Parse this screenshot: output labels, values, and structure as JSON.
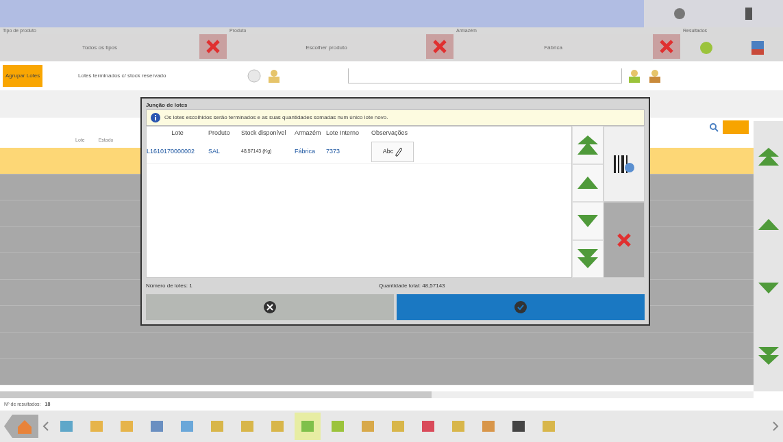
{
  "filters": [
    {
      "label": "Tipo de produto",
      "value": "Todos os tipos"
    },
    {
      "label": "Produto",
      "value": "Escolher produto"
    },
    {
      "label": "Armazém",
      "value": "Fábrica"
    }
  ],
  "results_label": "Resultados",
  "group_button": {
    "label": "Agrupar Lotes",
    "selected": true
  },
  "finished_filter": "Lotes terminados c/ stock reservado",
  "table": {
    "columns": [
      "Lote",
      "Estado"
    ],
    "rows": [
      {
        "selected": true
      },
      {
        "selected": false
      },
      {
        "selected": false
      },
      {
        "selected": false
      },
      {
        "selected": false
      },
      {
        "selected": false
      },
      {
        "selected": false
      },
      {
        "selected": false
      },
      {
        "selected": false
      }
    ]
  },
  "footer": {
    "results_label": "Nº de resultados:",
    "results_count": "18"
  },
  "toolbar": {
    "items": [
      {
        "selected": false
      },
      {
        "selected": false
      },
      {
        "selected": false
      },
      {
        "selected": false
      },
      {
        "selected": false
      },
      {
        "selected": false
      },
      {
        "selected": false
      },
      {
        "selected": false
      },
      {
        "selected": true
      },
      {
        "selected": false
      },
      {
        "selected": false
      },
      {
        "selected": false
      },
      {
        "selected": false
      },
      {
        "selected": false
      },
      {
        "selected": false
      },
      {
        "selected": false
      },
      {
        "selected": false
      }
    ]
  },
  "dialog": {
    "title": "Junção de lotes",
    "info": "Os lotes escolhidos serão terminados e as suas quantidades somadas num único lote novo.",
    "columns": [
      "Lote",
      "Produto",
      "Stock disponível",
      "Armazém",
      "Lote Interno",
      "Observações"
    ],
    "rows": [
      {
        "lote": "L1610170000002",
        "produto": "SAL",
        "stock": "48,57143 (Kg)",
        "armazem": "Fábrica",
        "lote_interno": "7373",
        "observacoes": "Abc"
      }
    ],
    "count": "Número de lotes: 1",
    "total": "Quantidade total: 48,57143"
  }
}
